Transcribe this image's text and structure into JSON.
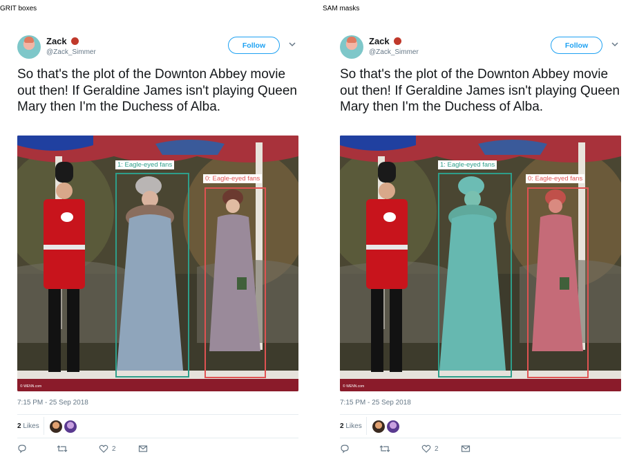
{
  "panels": [
    {
      "label": "GRIT boxes",
      "mask": false
    },
    {
      "label": "SAM masks",
      "mask": true
    }
  ],
  "tweet": {
    "name": "Zack",
    "handle": "@Zack_Simmer",
    "follow_label": "Follow",
    "text": "So that's the plot of the Downton Abbey movie out then! If Geraldine James isn't playing Queen Mary then I'm the Duchess of Alba.",
    "timestamp": "7:15 PM - 25 Sep 2018",
    "likes_count": "2",
    "likes_label": "Likes",
    "like_action_count": "2",
    "watermark": "© WENN.com",
    "icons": [
      "reply-icon",
      "retweet-icon",
      "heart-icon",
      "mail-icon",
      "chevron-down-icon",
      "bug-icon"
    ]
  },
  "detections": [
    {
      "label": "1: Eagle-eyed fans",
      "color": "#2e9e8a"
    },
    {
      "label": "0: Eagle-eyed fans",
      "color": "#e05252"
    }
  ]
}
